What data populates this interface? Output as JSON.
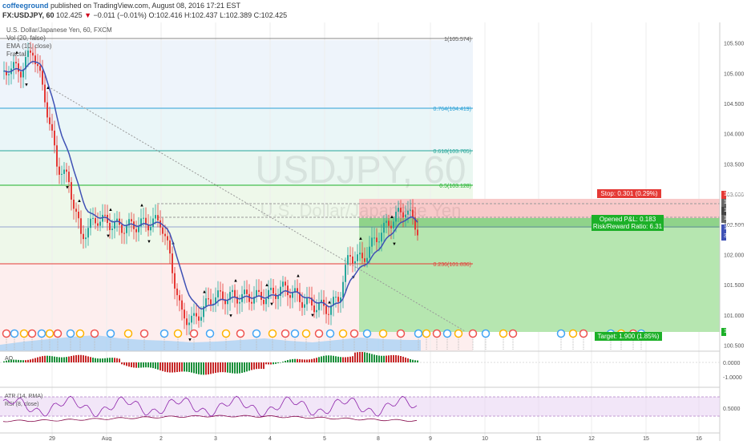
{
  "header": {
    "user": "coffeeground",
    "published_text": "published on TradingView.com, August 08, 2016 17:21 EST",
    "symbol": "FX:USDJPY, 60",
    "last": "102.425",
    "change_arrow": "▼",
    "change": "−0.011 (−0.01%)",
    "o": "O:102.416",
    "h": "H:102.437",
    "l": "L:102.389",
    "c": "C:102.425"
  },
  "legend": {
    "instrument": "U.S. Dollar/Japanese Yen, 60, FXCM",
    "vol": "Vol (20, false)",
    "ema": "EMA (10, close)",
    "fractal": "Fractal"
  },
  "watermark": {
    "big": "USDJPY, 60",
    "small": "U.S. Dollar/Japanese Yen"
  },
  "fib_levels": [
    {
      "label": "1(105.574)",
      "price": 105.574,
      "color": "#888888"
    },
    {
      "label": "0.764(104.419)",
      "price": 104.419,
      "color": "#2a9fd6"
    },
    {
      "label": "0.618(103.705)",
      "price": 103.705,
      "color": "#26a69a"
    },
    {
      "label": "0.5(103.128)",
      "price": 103.128,
      "color": "#1cb028"
    },
    {
      "label": "0.236(101.836)",
      "price": 101.836,
      "color": "#e53935"
    }
  ],
  "price_axis": {
    "ticks": [
      "105.500",
      "105.000",
      "104.500",
      "104.000",
      "103.500",
      "103.000",
      "102.500",
      "102.000",
      "101.500",
      "101.000",
      "100.500"
    ],
    "stop_price": "102.909",
    "p1": "102.831",
    "p2": "102.608",
    "p3": "102.605",
    "p4": "102.500",
    "last": "102.425",
    "timer": "38:51",
    "target_price": "100.708"
  },
  "position": {
    "stop": "Stop: 0.301 (0.29%)",
    "pnl": "Opened P&L: 0.183",
    "rr": "Risk/Reward Ratio: 6.31",
    "target": "Target: 1.900 (1.85%)"
  },
  "time_axis": [
    "29",
    "Aug",
    "2",
    "3",
    "4",
    "5",
    "8",
    "9",
    "10",
    "11",
    "12",
    "15",
    "16"
  ],
  "ao": {
    "label": "AO",
    "ticks": [
      "0.0000",
      "-1.0000"
    ]
  },
  "atr": {
    "label": "ATR (14, RMA)",
    "rsi_label": "RSI (8, close)",
    "tick": "0.5000"
  },
  "colors": {
    "up": "#26a69a",
    "down": "#e53935",
    "ema": "#3f51b5",
    "stop_fill": "#f8c9c9",
    "target_fill": "#b6e6b0"
  }
}
